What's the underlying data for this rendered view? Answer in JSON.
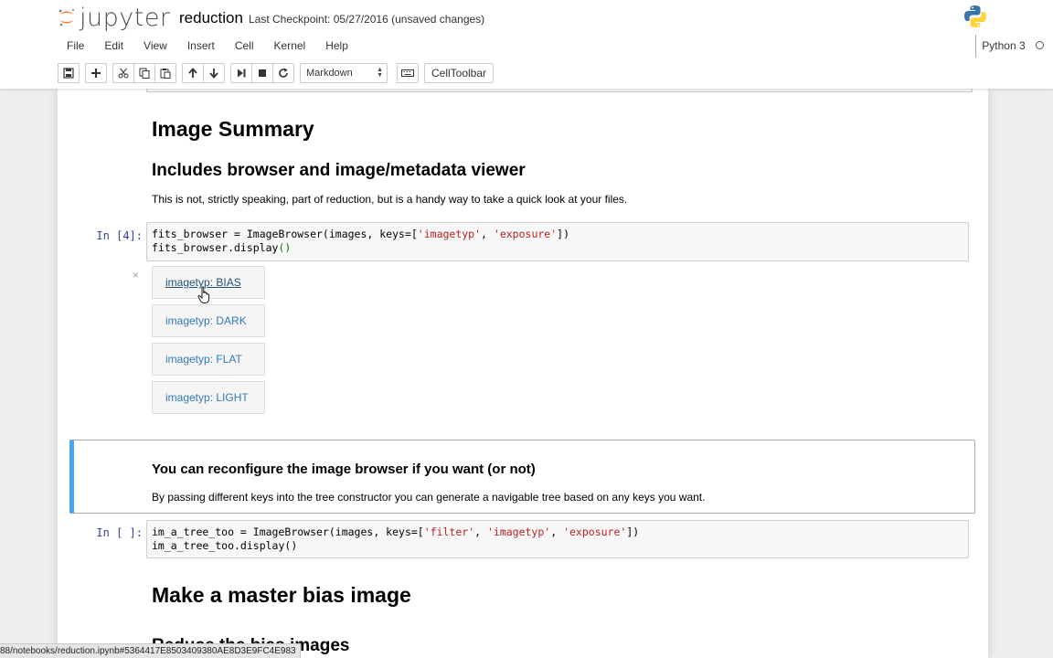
{
  "app": {
    "brand": "jupyter",
    "notebook_name": "reduction",
    "checkpoint": "Last Checkpoint: 05/27/2016 (unsaved changes)",
    "kernel": "Python 3"
  },
  "menu": [
    "File",
    "Edit",
    "View",
    "Insert",
    "Cell",
    "Kernel",
    "Help"
  ],
  "toolbar": {
    "icons": [
      "save-icon",
      "plus-icon",
      "cut-icon",
      "copy-icon",
      "paste-icon",
      "arrow-up-icon",
      "arrow-down-icon",
      "step-forward-icon",
      "stop-icon",
      "restart-icon",
      "keyboard-icon"
    ],
    "cell_type": "Markdown",
    "celltoolbar_label": "CellToolbar"
  },
  "cells": {
    "h1_summary": "Image Summary",
    "h2_browser": "Includes browser and image/metadata viewer",
    "p_browser": "This is not, strictly speaking, part of reduction, but is a handy way to take a quick look at your files.",
    "code4": {
      "prompt": "In [4]:",
      "line1_a": "fits_browser = ImageBrowser(images, keys=[",
      "line1_s1": "'imagetyp'",
      "line1_b": ", ",
      "line1_s2": "'exposure'",
      "line1_c": "])",
      "line2_a": "fits_browser.display",
      "line2_p": "()"
    },
    "output_close": "×",
    "image_buttons": [
      "imagetyp: BIAS",
      "imagetyp: DARK",
      "imagetyp: FLAT",
      "imagetyp: LIGHT"
    ],
    "h3_reconfigure": "You can reconfigure the image browser if you want (or not)",
    "p_reconfigure": "By passing different keys into the tree constructor you can generate a navigable tree based on any keys you want.",
    "code_tree": {
      "prompt": "In [ ]:",
      "line1_a": "im_a_tree_too = ImageBrowser(images, keys=[",
      "line1_s1": "'filter'",
      "line1_b": ", ",
      "line1_s2": "'imagetyp'",
      "line1_c": ", ",
      "line1_s3": "'exposure'",
      "line1_d": "])",
      "line2": "im_a_tree_too.display()"
    },
    "h1_master_bias": "Make a master bias image",
    "h2_partial": "Reduce the bias images"
  },
  "status_url": "88/notebooks/reduction.ipynb#5364417E8503409380AE8D3E9FC4E983",
  "colors": {
    "accent": "#42a5f5",
    "prompt": "#303f9f",
    "string": "#ba2121",
    "link": "#337ab7"
  }
}
